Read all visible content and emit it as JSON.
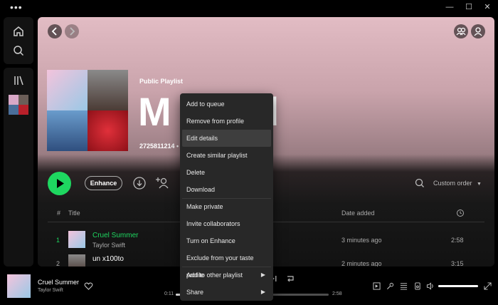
{
  "titlebar": {
    "menu_dots": "•••",
    "minimize": "—",
    "maximize": "☐",
    "close": "✕"
  },
  "playlist": {
    "type_label": "Public Playlist",
    "title": "M",
    "title_tail": "d",
    "meta": "2725811214 • 1",
    "enhance_label": "Enhance",
    "sort_label": "Custom order"
  },
  "table": {
    "col_num": "#",
    "col_title": "Title",
    "col_date": "Date added",
    "rows": [
      {
        "num": "1",
        "title": "Cruel Summer",
        "artist": "Taylor Swift",
        "date": "3 minutes ago",
        "duration": "2:58"
      },
      {
        "num": "2",
        "title": "un x100to",
        "artist": "",
        "date": "2 minutes ago",
        "duration": "3:15"
      }
    ]
  },
  "player": {
    "track": "Cruel Summer",
    "artist": "Taylor Swift",
    "elapsed": "0:11",
    "total": "2:58",
    "progress_fraction": 0.06,
    "volume_fraction": 1.0
  },
  "context_menu": {
    "items": [
      {
        "label": "Add to queue"
      },
      {
        "label": "Remove from profile"
      },
      {
        "label": "Edit details",
        "highlighted": true
      },
      {
        "label": "Create similar playlist"
      },
      {
        "label": "Delete"
      },
      {
        "label": "Download"
      },
      {
        "label": "Make private"
      },
      {
        "label": "Invite collaborators"
      },
      {
        "label": "Turn on Enhance"
      },
      {
        "label": "Exclude from your taste profile"
      },
      {
        "label": "Add to other playlist",
        "submenu": true
      },
      {
        "label": "Share",
        "submenu": true
      }
    ]
  },
  "colors": {
    "accent": "#1ed760",
    "header_top": "#e2bcc4",
    "menu_bg": "#282828",
    "menu_highlight": "#3e3e3e"
  }
}
